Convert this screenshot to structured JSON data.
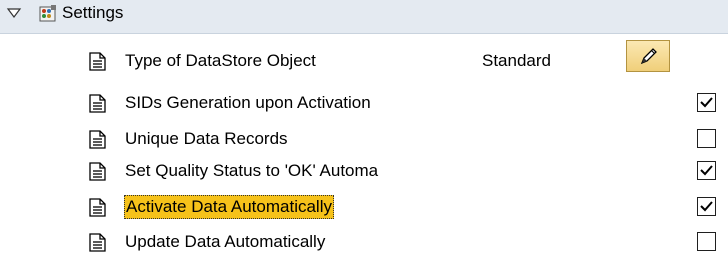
{
  "header": {
    "label": "Settings",
    "expanded": true,
    "icon": "settings-icon"
  },
  "rows": [
    {
      "label": "Type of DataStore Object",
      "value": "Standard",
      "control": "edit-button"
    },
    {
      "label": "SIDs Generation upon Activation",
      "checked": true
    },
    {
      "label": "Unique Data Records",
      "checked": false
    },
    {
      "label": "Set Quality Status to 'OK' Automa",
      "checked": true
    },
    {
      "label": "Activate Data Automatically",
      "checked": true,
      "selected": true
    },
    {
      "label": "Update Data Automatically",
      "checked": false
    }
  ],
  "colors": {
    "header_bg": "#e4eaf1",
    "selection": "#f6c21a",
    "edit_button": "#f0cf7a"
  }
}
